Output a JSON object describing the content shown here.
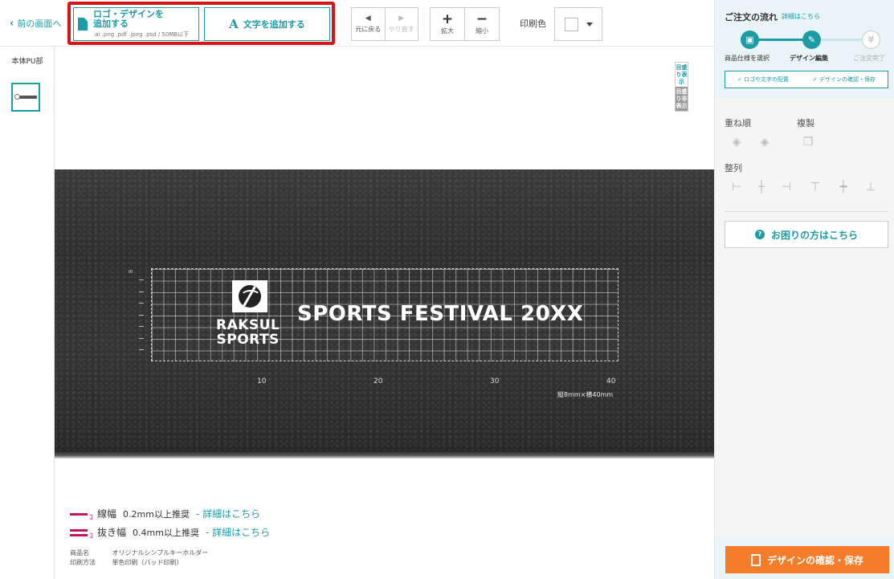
{
  "toolbar": {
    "back_label": "前の画面へ",
    "add_logo_line1": "ロゴ・デザインを",
    "add_logo_line2": "追加する",
    "add_logo_formats": ".ai .png .pdf .jpeg .psd / 50MB以下",
    "add_text_label": "文字を追加する",
    "undo_label": "元に戻る",
    "redo_label": "やり直す",
    "zoom_in_label": "拡大",
    "zoom_out_label": "縮小",
    "print_color_label": "印刷色",
    "highlight_color": "#d7141a"
  },
  "parts": {
    "label": "本体PU部"
  },
  "canvas": {
    "grid_on": "目盛り表示",
    "grid_off": "目盛り非表示",
    "ruler_v_label": "8",
    "ruler_ticks": [
      "10",
      "20",
      "30",
      "40"
    ],
    "size_note": "縦8mm×横40mm",
    "logo_line1": "RAKSUL",
    "logo_line2": "SPORTS",
    "headline": "SPORTS FESTIVAL 20XX"
  },
  "recommend": {
    "line_label": "線幅",
    "line_value": "0.2mm以上推奨",
    "line_link": "- 詳細はこちら",
    "gap_label": "抜き幅",
    "gap_value": "0.4mm以上推奨",
    "gap_link": "- 詳細はこちら",
    "accent": "#c2185b"
  },
  "meta": {
    "product_key": "商品名",
    "product_value": "オリジナルシンプルキーホルダー",
    "method_key": "印刷方法",
    "method_value": "単色印刷（パッド印刷）"
  },
  "flow": {
    "title": "ご注文の流れ",
    "detail_link": "詳細はこちら",
    "steps": [
      {
        "label": "商品仕様を選択",
        "icon": "gift-icon"
      },
      {
        "label": "デザイン編集",
        "icon": "pencil-icon"
      },
      {
        "label": "ご注文完了",
        "icon": "yen-icon"
      }
    ],
    "substep1": "✓ ロゴや文字の配置",
    "substep2": "✓ デザインの確認・保存"
  },
  "panel": {
    "order_label": "重ね順",
    "duplicate_label": "複製",
    "align_label": "整列",
    "help_label": "お困りの方はこちら",
    "save_label": "デザインの確認・保存",
    "accent": "#1f9ba6",
    "save_color": "#f57c28"
  }
}
